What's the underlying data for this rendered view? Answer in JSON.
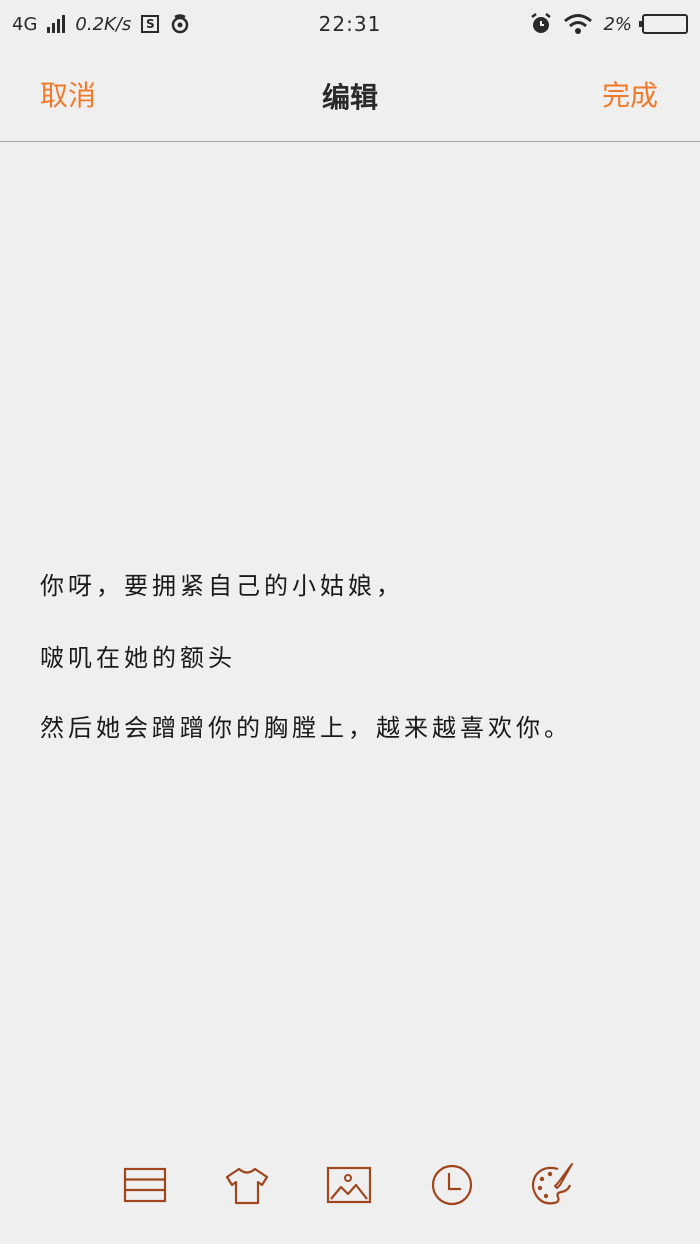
{
  "status_bar": {
    "network": "4G",
    "speed": "0.2K/s",
    "s_badge": "S",
    "time": "22:31",
    "battery_text": "2%"
  },
  "header": {
    "cancel_label": "取消",
    "title": "编辑",
    "done_label": "完成"
  },
  "note": {
    "lines": [
      "你呀，要拥紧自己的小姑娘，",
      "啵叽在她的额头",
      "然后她会蹭蹭你的胸膛上，越来越喜欢你。"
    ]
  },
  "toolbar": {
    "icons": [
      "list-icon",
      "tshirt-icon",
      "image-icon",
      "clock-icon",
      "palette-icon"
    ]
  },
  "colors": {
    "accent": "#f07a2a",
    "icon": "#a0461f",
    "background": "#efefef"
  }
}
